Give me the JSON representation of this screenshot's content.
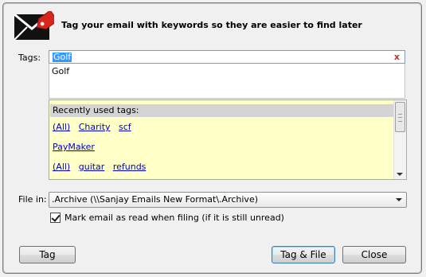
{
  "header": {
    "title": "Tag your email with keywords so they are easier to find later",
    "icon": "email-tag-icon"
  },
  "tags": {
    "label": "Tags:",
    "value": "Golf",
    "clear_icon_text": "x"
  },
  "suggestions": [
    "Golf"
  ],
  "recent": {
    "header": "Recently used tags:",
    "rows": [
      [
        "(All)",
        "Charity",
        "scf"
      ],
      [
        "PayMaker"
      ],
      [
        "(All)",
        "guitar",
        "refunds"
      ]
    ]
  },
  "file_in": {
    "label": "File in:",
    "value": ".Archive (\\\\Sanjay Emails New Format\\.Archive)"
  },
  "mark_read": {
    "checked": true,
    "label": "Mark email as read when filing (if it is still unread)"
  },
  "buttons": {
    "tag": "Tag",
    "tag_file": "Tag & File",
    "close": "Close"
  },
  "colors": {
    "recent_bg": "#ffffc8",
    "link": "#0000cc",
    "selection": "#3399ff"
  }
}
